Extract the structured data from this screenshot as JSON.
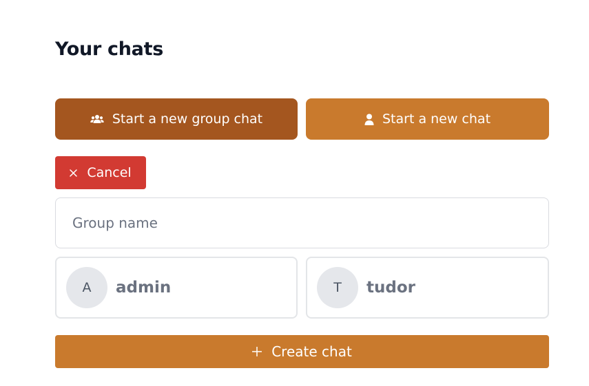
{
  "header": {
    "title": "Your chats"
  },
  "mode_buttons": {
    "group": {
      "label": "Start a new group chat",
      "icon": "users-icon",
      "color": "#a4561f"
    },
    "single": {
      "label": "Start a new chat",
      "icon": "user-icon",
      "color": "#c97a2d"
    }
  },
  "cancel": {
    "label": "Cancel",
    "icon": "close-icon",
    "color": "#d23a32"
  },
  "group_name": {
    "placeholder": "Group name",
    "value": ""
  },
  "users": [
    {
      "initial": "A",
      "name": "admin"
    },
    {
      "initial": "T",
      "name": "tudor"
    }
  ],
  "create": {
    "label": "Create chat",
    "icon": "plus-icon",
    "color": "#c97a2d"
  }
}
